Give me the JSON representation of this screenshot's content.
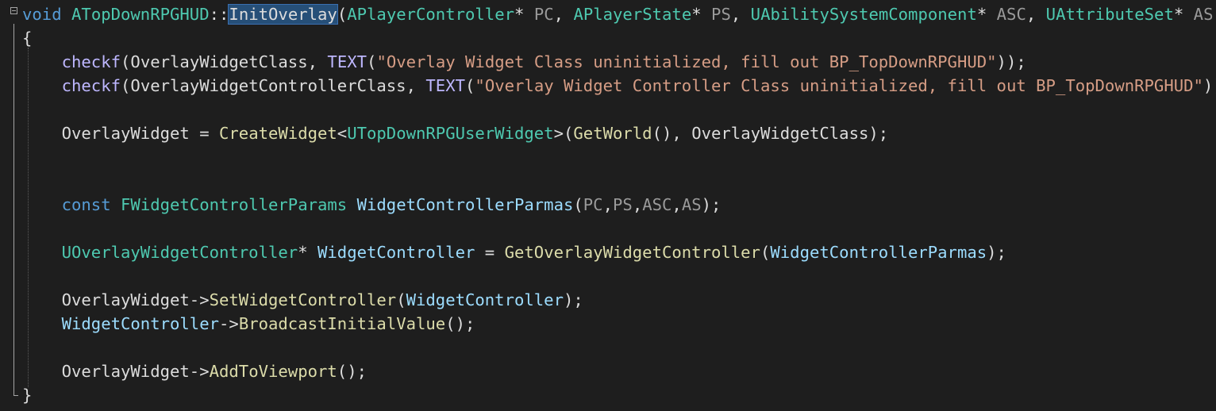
{
  "editor": {
    "lines": [
      [
        {
          "t": "void",
          "c": "kw"
        },
        {
          "t": " ",
          "c": "plain"
        },
        {
          "t": "ATopDownRPGHUD",
          "c": "type"
        },
        {
          "t": "::",
          "c": "plain"
        },
        {
          "t": "InitOverlay",
          "c": "fn sel"
        },
        {
          "t": "(",
          "c": "plain"
        },
        {
          "t": "APlayerController",
          "c": "type"
        },
        {
          "t": "* ",
          "c": "plain"
        },
        {
          "t": "PC",
          "c": "param"
        },
        {
          "t": ", ",
          "c": "plain"
        },
        {
          "t": "APlayerState",
          "c": "type"
        },
        {
          "t": "* ",
          "c": "plain"
        },
        {
          "t": "PS",
          "c": "param"
        },
        {
          "t": ", ",
          "c": "plain"
        },
        {
          "t": "UAbilitySystemComponent",
          "c": "type"
        },
        {
          "t": "* ",
          "c": "plain"
        },
        {
          "t": "ASC",
          "c": "param"
        },
        {
          "t": ", ",
          "c": "plain"
        },
        {
          "t": "UAttributeSet",
          "c": "type"
        },
        {
          "t": "* ",
          "c": "plain"
        },
        {
          "t": "AS",
          "c": "param"
        },
        {
          "t": ")",
          "c": "plain"
        }
      ],
      [
        {
          "t": "{",
          "c": "plain"
        }
      ],
      [
        {
          "t": "    ",
          "c": "plain"
        },
        {
          "t": "checkf",
          "c": "macro"
        },
        {
          "t": "(",
          "c": "plain"
        },
        {
          "t": "OverlayWidgetClass",
          "c": "plain"
        },
        {
          "t": ", ",
          "c": "plain"
        },
        {
          "t": "TEXT",
          "c": "macro"
        },
        {
          "t": "(",
          "c": "plain"
        },
        {
          "t": "\"Overlay Widget Class uninitialized, fill out BP_TopDownRPGHUD\"",
          "c": "str"
        },
        {
          "t": "));",
          "c": "plain"
        }
      ],
      [
        {
          "t": "    ",
          "c": "plain"
        },
        {
          "t": "checkf",
          "c": "macro"
        },
        {
          "t": "(",
          "c": "plain"
        },
        {
          "t": "OverlayWidgetControllerClass",
          "c": "plain"
        },
        {
          "t": ", ",
          "c": "plain"
        },
        {
          "t": "TEXT",
          "c": "macro"
        },
        {
          "t": "(",
          "c": "plain"
        },
        {
          "t": "\"Overlay Widget Controller Class uninitialized, fill out BP_TopDownRPGHUD\"",
          "c": "str"
        },
        {
          "t": "));",
          "c": "plain"
        }
      ],
      [],
      [
        {
          "t": "    ",
          "c": "plain"
        },
        {
          "t": "OverlayWidget",
          "c": "plain"
        },
        {
          "t": " = ",
          "c": "plain"
        },
        {
          "t": "CreateWidget",
          "c": "fn"
        },
        {
          "t": "<",
          "c": "plain"
        },
        {
          "t": "UTopDownRPGUserWidget",
          "c": "type"
        },
        {
          "t": ">(",
          "c": "plain"
        },
        {
          "t": "GetWorld",
          "c": "fn"
        },
        {
          "t": "(), ",
          "c": "plain"
        },
        {
          "t": "OverlayWidgetClass",
          "c": "plain"
        },
        {
          "t": ");",
          "c": "plain"
        }
      ],
      [],
      [],
      [
        {
          "t": "    ",
          "c": "plain"
        },
        {
          "t": "const",
          "c": "kw"
        },
        {
          "t": " ",
          "c": "plain"
        },
        {
          "t": "FWidgetControllerParams",
          "c": "type"
        },
        {
          "t": " ",
          "c": "plain"
        },
        {
          "t": "WidgetControllerParmas",
          "c": "var"
        },
        {
          "t": "(",
          "c": "plain"
        },
        {
          "t": "PC",
          "c": "param"
        },
        {
          "t": ",",
          "c": "plain"
        },
        {
          "t": "PS",
          "c": "param"
        },
        {
          "t": ",",
          "c": "plain"
        },
        {
          "t": "ASC",
          "c": "param"
        },
        {
          "t": ",",
          "c": "plain"
        },
        {
          "t": "AS",
          "c": "param"
        },
        {
          "t": ");",
          "c": "plain"
        }
      ],
      [],
      [
        {
          "t": "    ",
          "c": "plain"
        },
        {
          "t": "UOverlayWidgetController",
          "c": "type"
        },
        {
          "t": "* ",
          "c": "plain"
        },
        {
          "t": "WidgetController",
          "c": "var"
        },
        {
          "t": " = ",
          "c": "plain"
        },
        {
          "t": "GetOverlayWidgetController",
          "c": "fn"
        },
        {
          "t": "(",
          "c": "plain"
        },
        {
          "t": "WidgetControllerParmas",
          "c": "var"
        },
        {
          "t": ");",
          "c": "plain"
        }
      ],
      [],
      [
        {
          "t": "    ",
          "c": "plain"
        },
        {
          "t": "OverlayWidget",
          "c": "plain"
        },
        {
          "t": "->",
          "c": "plain"
        },
        {
          "t": "SetWidgetController",
          "c": "fn"
        },
        {
          "t": "(",
          "c": "plain"
        },
        {
          "t": "WidgetController",
          "c": "var"
        },
        {
          "t": ");",
          "c": "plain"
        }
      ],
      [
        {
          "t": "    ",
          "c": "plain"
        },
        {
          "t": "WidgetController",
          "c": "var"
        },
        {
          "t": "->",
          "c": "plain"
        },
        {
          "t": "BroadcastInitialValue",
          "c": "fn"
        },
        {
          "t": "();",
          "c": "plain"
        }
      ],
      [],
      [
        {
          "t": "    ",
          "c": "plain"
        },
        {
          "t": "OverlayWidget",
          "c": "plain"
        },
        {
          "t": "->",
          "c": "plain"
        },
        {
          "t": "AddToViewport",
          "c": "fn"
        },
        {
          "t": "();",
          "c": "plain"
        }
      ],
      [
        {
          "t": "}",
          "c": "plain"
        }
      ]
    ]
  }
}
